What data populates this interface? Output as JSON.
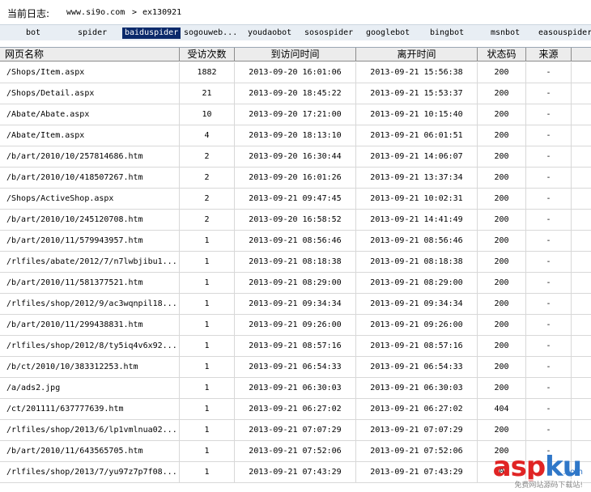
{
  "header": {
    "log_label": "当前日志:",
    "site": "www.si9o.com",
    "separator": ">",
    "file": "ex130921"
  },
  "bots": [
    {
      "label": "bot",
      "active": false
    },
    {
      "label": "spider",
      "active": false
    },
    {
      "label": "baiduspider",
      "active": true
    },
    {
      "label": "sogouweb...",
      "active": false
    },
    {
      "label": "youdaobot",
      "active": false
    },
    {
      "label": "sosospider",
      "active": false
    },
    {
      "label": "googlebot",
      "active": false
    },
    {
      "label": "bingbot",
      "active": false
    },
    {
      "label": "msnbot",
      "active": false
    },
    {
      "label": "easouspider",
      "active": false
    }
  ],
  "columns": [
    "网页名称",
    "受访次数",
    "到访问时间",
    "离开时间",
    "状态码",
    "来源"
  ],
  "rows": [
    [
      "/Shops/Item.aspx",
      "1882",
      "2013-09-20 16:01:06",
      "2013-09-21 15:56:38",
      "200",
      "-"
    ],
    [
      "/Shops/Detail.aspx",
      "21",
      "2013-09-20 18:45:22",
      "2013-09-21 15:53:37",
      "200",
      "-"
    ],
    [
      "/Abate/Abate.aspx",
      "10",
      "2013-09-20 17:21:00",
      "2013-09-21 10:15:40",
      "200",
      "-"
    ],
    [
      "/Abate/Item.aspx",
      "4",
      "2013-09-20 18:13:10",
      "2013-09-21 06:01:51",
      "200",
      "-"
    ],
    [
      "/b/art/2010/10/257814686.htm",
      "2",
      "2013-09-20 16:30:44",
      "2013-09-21 14:06:07",
      "200",
      "-"
    ],
    [
      "/b/art/2010/10/418507267.htm",
      "2",
      "2013-09-20 16:01:26",
      "2013-09-21 13:37:34",
      "200",
      "-"
    ],
    [
      "/Shops/ActiveShop.aspx",
      "2",
      "2013-09-21 09:47:45",
      "2013-09-21 10:02:31",
      "200",
      "-"
    ],
    [
      "/b/art/2010/10/245120708.htm",
      "2",
      "2013-09-20 16:58:52",
      "2013-09-21 14:41:49",
      "200",
      "-"
    ],
    [
      "/b/art/2010/11/579943957.htm",
      "1",
      "2013-09-21 08:56:46",
      "2013-09-21 08:56:46",
      "200",
      "-"
    ],
    [
      "/rlfiles/abate/2012/7/n7lwbjibu1...",
      "1",
      "2013-09-21 08:18:38",
      "2013-09-21 08:18:38",
      "200",
      "-"
    ],
    [
      "/b/art/2010/11/581377521.htm",
      "1",
      "2013-09-21 08:29:00",
      "2013-09-21 08:29:00",
      "200",
      "-"
    ],
    [
      "/rlfiles/shop/2012/9/ac3wqnpil18...",
      "1",
      "2013-09-21 09:34:34",
      "2013-09-21 09:34:34",
      "200",
      "-"
    ],
    [
      "/b/art/2010/11/299438831.htm",
      "1",
      "2013-09-21 09:26:00",
      "2013-09-21 09:26:00",
      "200",
      "-"
    ],
    [
      "/rlfiles/shop/2012/8/ty5iq4v6x92...",
      "1",
      "2013-09-21 08:57:16",
      "2013-09-21 08:57:16",
      "200",
      "-"
    ],
    [
      "/b/ct/2010/10/383312253.htm",
      "1",
      "2013-09-21 06:54:33",
      "2013-09-21 06:54:33",
      "200",
      "-"
    ],
    [
      "/a/ads2.jpg",
      "1",
      "2013-09-21 06:30:03",
      "2013-09-21 06:30:03",
      "200",
      "-"
    ],
    [
      "/ct/201111/637777639.htm",
      "1",
      "2013-09-21 06:27:02",
      "2013-09-21 06:27:02",
      "404",
      "-"
    ],
    [
      "/rlfiles/shop/2013/6/lp1vmlnua02...",
      "1",
      "2013-09-21 07:07:29",
      "2013-09-21 07:07:29",
      "200",
      "-"
    ],
    [
      "/b/art/2010/11/643565705.htm",
      "1",
      "2013-09-21 07:52:06",
      "2013-09-21 07:52:06",
      "200",
      "-"
    ],
    [
      "/rlfiles/shop/2013/7/yu97z7p7f08...",
      "1",
      "2013-09-21 07:43:29",
      "2013-09-21 07:43:29",
      "200",
      "-"
    ]
  ],
  "watermark": {
    "logo_part1": "asp",
    "logo_part2": "ku",
    "domain": ".com",
    "subtitle": "免费网站源码下载站!"
  }
}
